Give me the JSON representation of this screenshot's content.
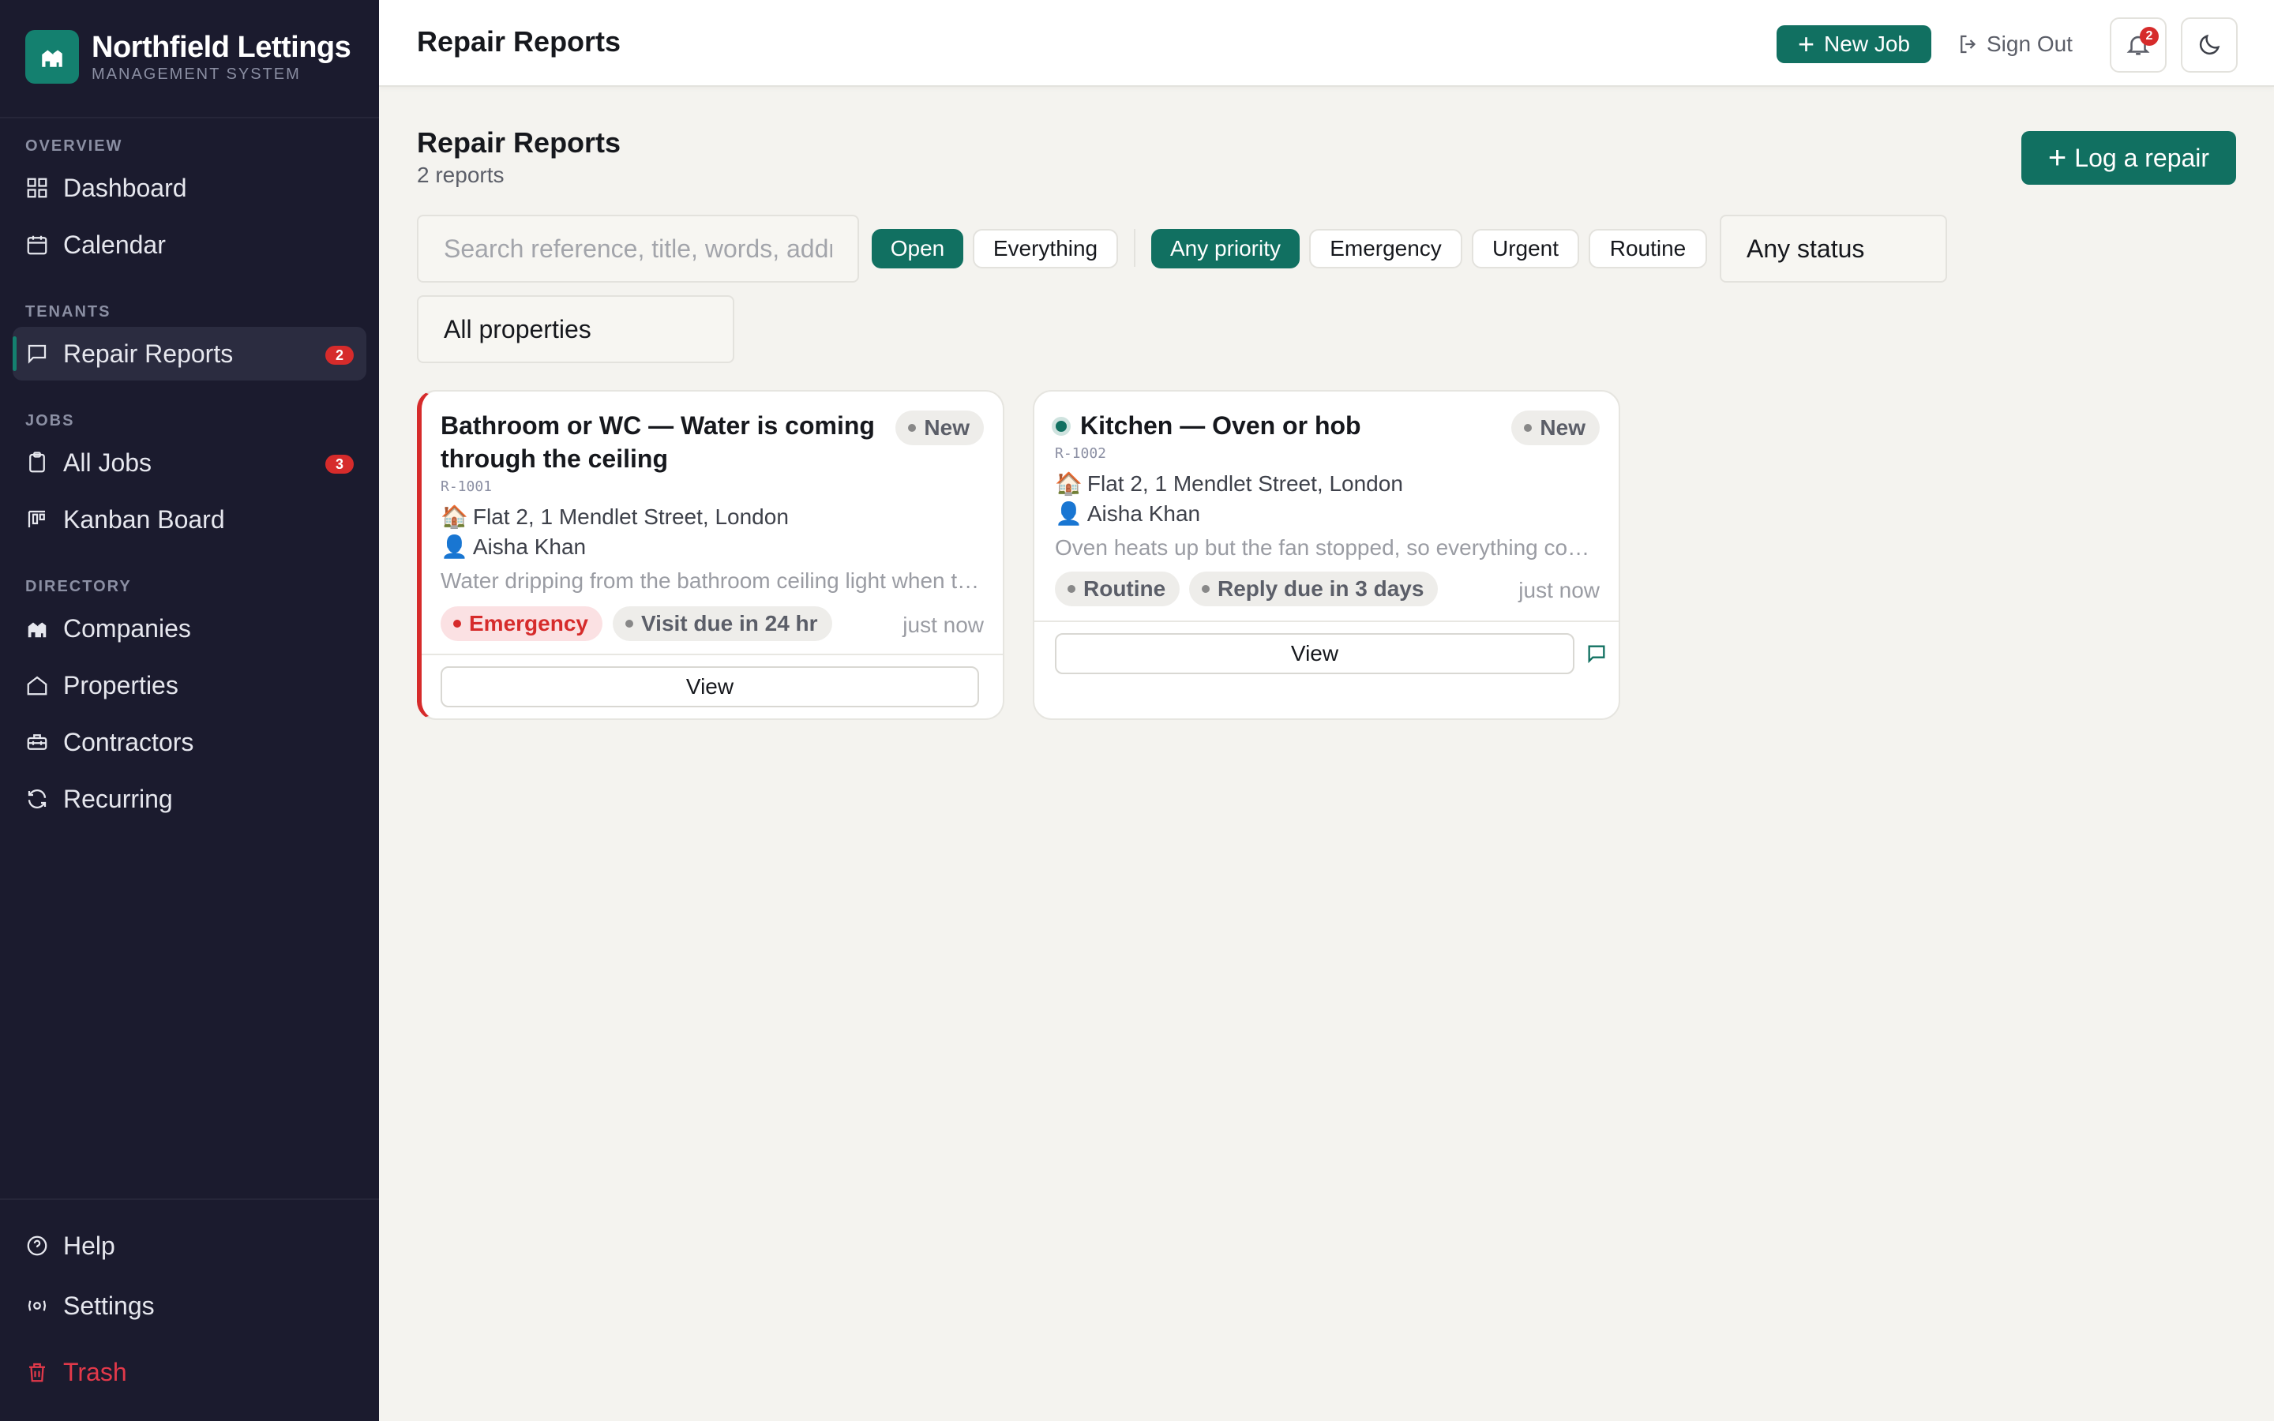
{
  "brand": {
    "name": "Northfield Lettings",
    "subtitle": "MANAGEMENT SYSTEM"
  },
  "sidebar": {
    "sections": [
      {
        "label": "OVERVIEW"
      },
      {
        "label": "TENANTS"
      },
      {
        "label": "JOBS"
      },
      {
        "label": "DIRECTORY"
      }
    ],
    "items": [
      {
        "label": "Dashboard",
        "icon": "grid-icon"
      },
      {
        "label": "Calendar",
        "icon": "calendar-icon"
      },
      {
        "label": "Repair Reports",
        "icon": "message-icon",
        "badge": "2",
        "active": true
      },
      {
        "label": "All Jobs",
        "icon": "clipboard-icon",
        "badge": "3"
      },
      {
        "label": "Kanban Board",
        "icon": "kanban-icon"
      },
      {
        "label": "Companies",
        "icon": "buildings-icon"
      },
      {
        "label": "Properties",
        "icon": "house-icon"
      },
      {
        "label": "Contractors",
        "icon": "toolbox-icon"
      },
      {
        "label": "Recurring",
        "icon": "refresh-icon"
      }
    ],
    "bottom": [
      {
        "label": "Help",
        "icon": "help-icon"
      },
      {
        "label": "Settings",
        "icon": "settings-icon"
      },
      {
        "label": "Trash",
        "icon": "trash-icon"
      }
    ]
  },
  "topbar": {
    "title": "Repair Reports",
    "new_job": "New Job",
    "sign_out": "Sign Out",
    "notifications": "2"
  },
  "main": {
    "title": "Repair Reports",
    "count": "2 reports",
    "log_repair": "Log a repair",
    "search_placeholder": "Search reference, title, words, address",
    "scope_filters": [
      {
        "label": "Open",
        "selected": true
      },
      {
        "label": "Everything",
        "selected": false
      }
    ],
    "priority_filters": [
      {
        "label": "Any priority",
        "selected": true
      },
      {
        "label": "Emergency",
        "selected": false
      },
      {
        "label": "Urgent",
        "selected": false
      },
      {
        "label": "Routine",
        "selected": false
      }
    ],
    "status_select": "Any status",
    "property_select": "All properties"
  },
  "reports": [
    {
      "title_line1": "Bathroom or WC — Water is coming",
      "title_line2": "through the ceiling",
      "status": "New",
      "ref": "R-1001",
      "address": "Flat 2, 1 Mendlet Street, London",
      "tenant": "Aisha Khan",
      "description": "Water dripping from the bathroom ceiling light when the upstairs shower is used",
      "priority": "Emergency",
      "due": "Visit due in 24 hr",
      "time": "just now",
      "view": "View"
    },
    {
      "title": "Kitchen — Oven or hob",
      "status": "New",
      "ref": "R-1002",
      "address": "Flat 2, 1 Mendlet Street, London",
      "tenant": "Aisha Khan",
      "description": "Oven heats up but the fan stopped, so everything cooks unevenly",
      "priority": "Routine",
      "due": "Reply due in 3 days",
      "time": "just now",
      "view": "View"
    }
  ],
  "colors": {
    "accent": "#117061",
    "sidebar": "#1b1b2e",
    "danger": "#d62b2b",
    "background": "#f4f3ef"
  }
}
